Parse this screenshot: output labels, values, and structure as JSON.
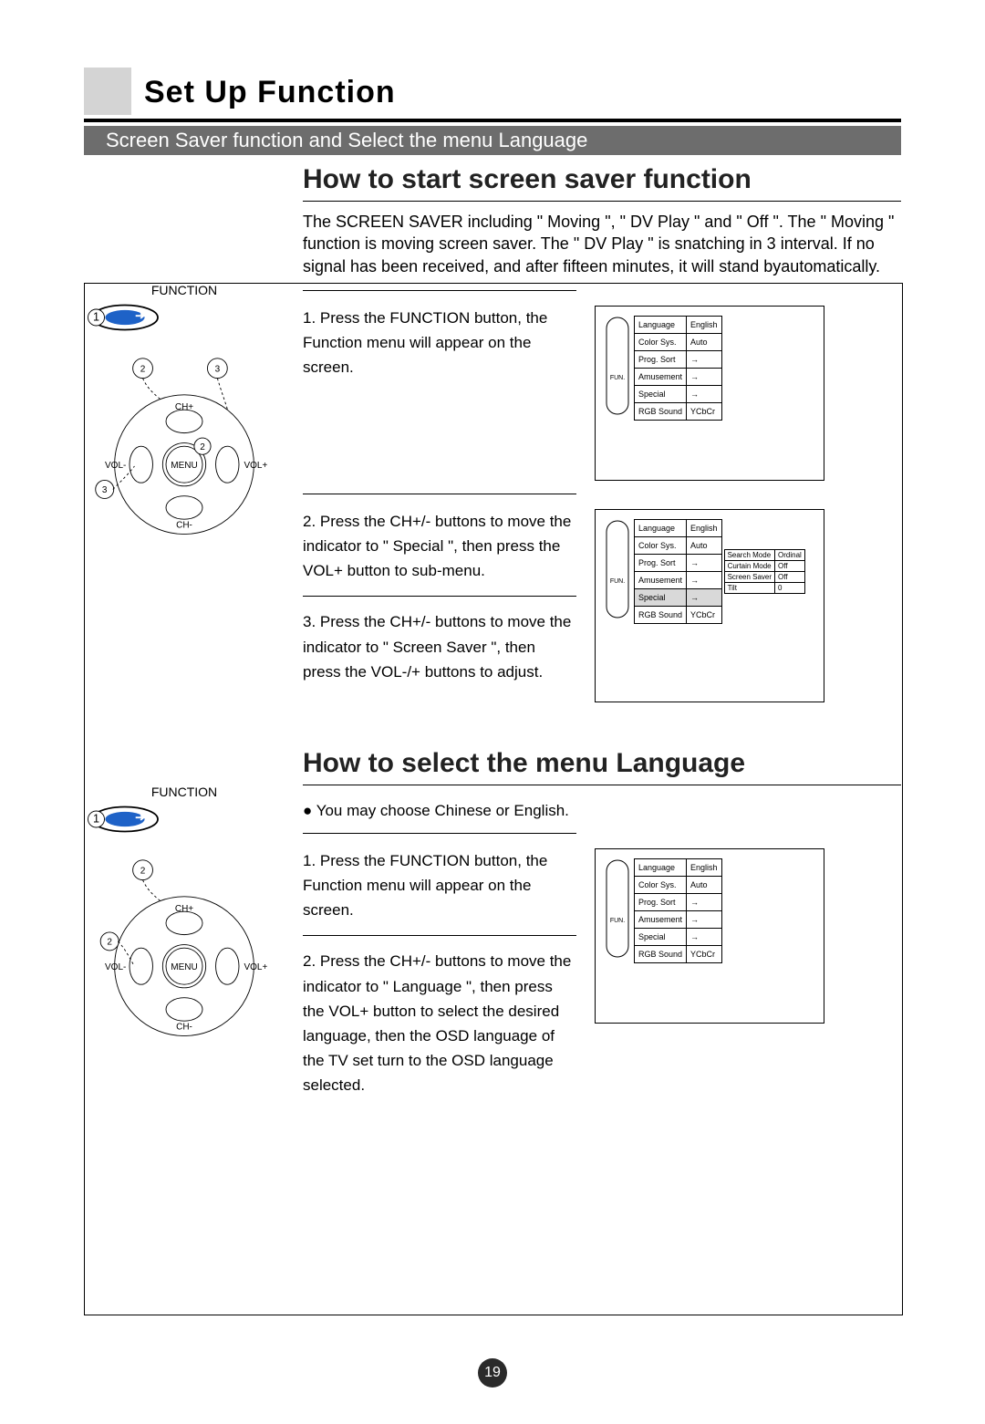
{
  "chapter_title": "Set Up Function",
  "section_bar": "Screen Saver function and Select the menu Language",
  "heading_a": "How to start screen saver function",
  "intro_a": "The SCREEN SAVER including \" Moving \", \" DV Play \" and \" Off \". The \" Moving \" function is moving screen saver. The \" DV Play \" is snatching in 3 interval. If no signal has been received, and after fifteen minutes, it will stand byautomatically.",
  "a_step1": "1. Press the FUNCTION button, the Function menu will appear on the screen.",
  "a_step2": "2. Press the CH+/- buttons to move the indicator to \" Special \", then press the VOL+ button to sub-menu.",
  "a_step3": "3. Press the CH+/- buttons to move the indicator to \" Screen Saver \", then press the VOL-/+ buttons  to adjust.",
  "heading_b": "How to select the menu Language",
  "bullet_b": "You may choose Chinese or English.",
  "b_step1": "1. Press the FUNCTION button, the Function menu will appear on the screen.",
  "b_step2": "2. Press the CH+/- buttons to move the indicator to \" Language \", then press the VOL+ button to select the desired language, then the OSD language of the TV set turn to the OSD language selected.",
  "function_label": "FUNCTION",
  "page_number": "19",
  "pad": {
    "ch_plus": "CH+",
    "ch_minus": "CH-",
    "vol_plus": "VOL+",
    "vol_minus": "VOL-",
    "menu": "MENU"
  },
  "callouts": {
    "n1": "1",
    "n2": "2",
    "n3": "3"
  },
  "osd": {
    "fun_label": "FUN.",
    "rows": [
      [
        "Language",
        "English"
      ],
      [
        "Color Sys.",
        "Auto"
      ],
      [
        "Prog. Sort",
        "→"
      ],
      [
        "Amusement",
        "→"
      ],
      [
        "Special",
        "→"
      ],
      [
        "RGB Sound",
        "YCbCr"
      ]
    ],
    "sub": [
      [
        "Search Mode",
        "Ordinal"
      ],
      [
        "Curtain Mode",
        "Off"
      ],
      [
        "Screen Saver",
        "Off"
      ],
      [
        "Tilt",
        "0"
      ]
    ]
  }
}
